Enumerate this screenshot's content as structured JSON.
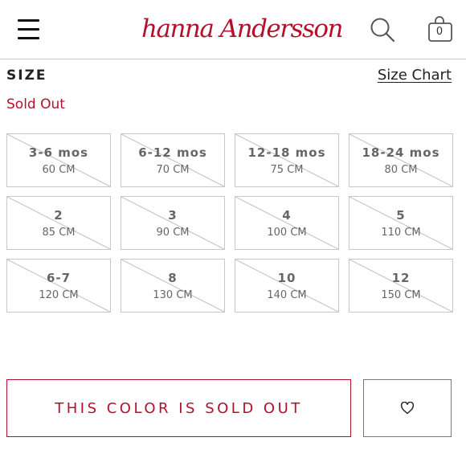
{
  "header": {
    "logo_text": "hanna Andersson",
    "menu_icon": "hamburger-menu-icon",
    "search_icon": "search-icon",
    "cart_icon": "shopping-bag-icon",
    "cart_count": "0",
    "brand_color": "#b3112b"
  },
  "size_section": {
    "label": "SIZE",
    "size_chart_link": "Size Chart",
    "status": "Sold Out",
    "sizes": [
      {
        "label": "3-6 mos",
        "cm": "60 CM",
        "available": false
      },
      {
        "label": "6-12 mos",
        "cm": "70 CM",
        "available": false
      },
      {
        "label": "12-18 mos",
        "cm": "75 CM",
        "available": false
      },
      {
        "label": "18-24 mos",
        "cm": "80 CM",
        "available": false
      },
      {
        "label": "2",
        "cm": "85 CM",
        "available": false
      },
      {
        "label": "3",
        "cm": "90 CM",
        "available": false
      },
      {
        "label": "4",
        "cm": "100 CM",
        "available": false
      },
      {
        "label": "5",
        "cm": "110 CM",
        "available": false
      },
      {
        "label": "6-7",
        "cm": "120 CM",
        "available": false
      },
      {
        "label": "8",
        "cm": "130 CM",
        "available": false
      },
      {
        "label": "10",
        "cm": "140 CM",
        "available": false
      },
      {
        "label": "12",
        "cm": "150 CM",
        "available": false
      }
    ]
  },
  "actions": {
    "sold_out_button": "THIS COLOR IS SOLD OUT",
    "wishlist_icon": "heart-icon"
  }
}
